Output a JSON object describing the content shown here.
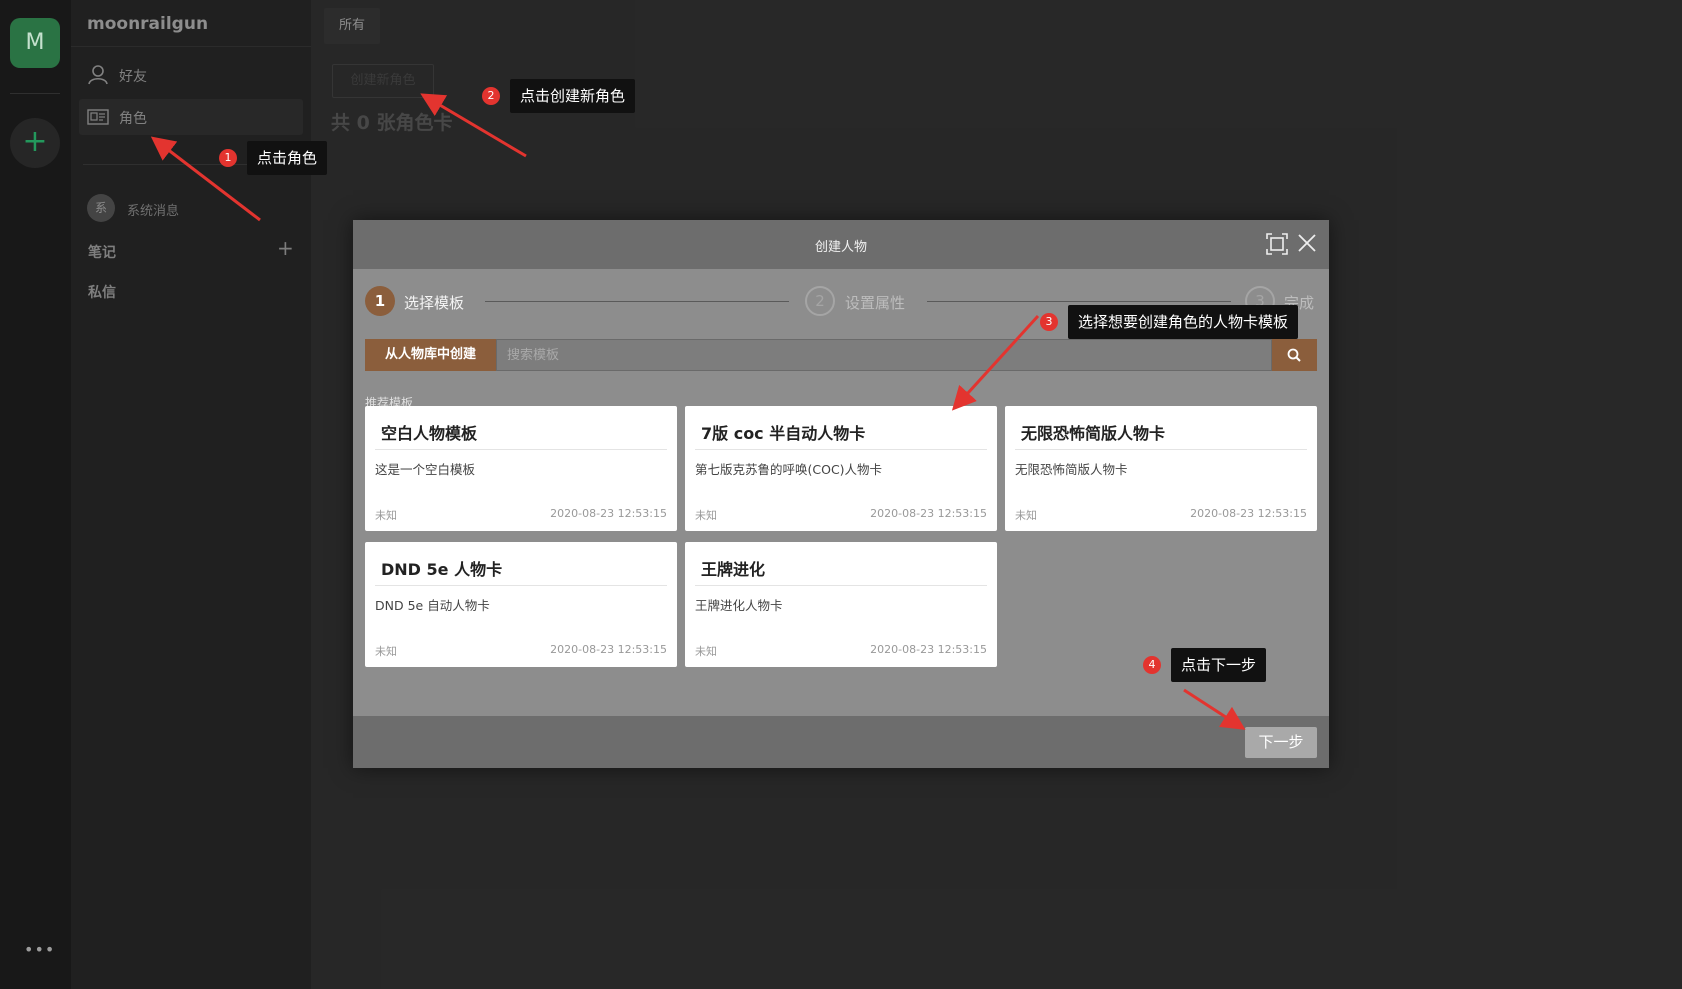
{
  "rail": {
    "avatar_letter": "M",
    "add_symbol": "+",
    "more_symbol": "•••"
  },
  "sidebar": {
    "username": "moonrailgun",
    "nav": [
      {
        "label": "好友",
        "icon": "user-icon"
      },
      {
        "label": "角色",
        "icon": "id-card-icon"
      }
    ],
    "system": {
      "avatar_text": "系",
      "label": "系统消息"
    },
    "notes_label": "笔记",
    "notes_add": "+",
    "dm_label": "私信"
  },
  "main": {
    "tab_label": "所有",
    "create_button": "创建新角色",
    "count_text": "共 0 张角色卡"
  },
  "modal": {
    "title": "创建人物",
    "steps": [
      {
        "num": "1",
        "label": "选择模板"
      },
      {
        "num": "2",
        "label": "设置属性"
      },
      {
        "num": "3",
        "label": "完成"
      }
    ],
    "search": {
      "mode_label": "从人物库中创建",
      "placeholder": "搜索模板"
    },
    "recommend_label": "推荐模板",
    "cards": [
      {
        "title": "空白人物模板",
        "desc": "这是一个空白模板",
        "author": "未知",
        "date": "2020-08-23 12:53:15"
      },
      {
        "title": "7版 coc 半自动人物卡",
        "desc": "第七版克苏鲁的呼唤(COC)人物卡",
        "author": "未知",
        "date": "2020-08-23 12:53:15"
      },
      {
        "title": "无限恐怖简版人物卡",
        "desc": "无限恐怖简版人物卡",
        "author": "未知",
        "date": "2020-08-23 12:53:15"
      },
      {
        "title": "DND 5e 人物卡",
        "desc": "DND 5e 自动人物卡",
        "author": "未知",
        "date": "2020-08-23 12:53:15"
      },
      {
        "title": "王牌进化",
        "desc": "王牌进化人物卡",
        "author": "未知",
        "date": "2020-08-23 12:53:15"
      }
    ],
    "next_button": "下一步"
  },
  "annotations": [
    {
      "num": "1",
      "text": "点击角色"
    },
    {
      "num": "2",
      "text": "点击创建新角色"
    },
    {
      "num": "3",
      "text": "选择想要创建角色的人物卡模板"
    },
    {
      "num": "4",
      "text": "点击下一步"
    }
  ],
  "colors": {
    "accent": "#8b5e3c",
    "rail_avatar": "#2e7d4a",
    "annotation_badge": "#e3342f",
    "modal_body": "#8d8d8d",
    "modal_header": "#6d6d6d"
  }
}
